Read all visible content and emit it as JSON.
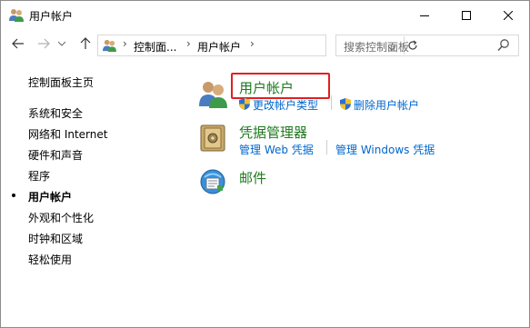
{
  "window": {
    "title": "用户帐户"
  },
  "nav": {
    "breadcrumb": [
      "控制面...",
      "用户帐户"
    ],
    "search_placeholder": "搜索控制面板"
  },
  "sidebar": {
    "items": [
      {
        "label": "控制面板主页",
        "current": false
      },
      {
        "label": "系统和安全",
        "current": false
      },
      {
        "label": "网络和 Internet",
        "current": false
      },
      {
        "label": "硬件和声音",
        "current": false
      },
      {
        "label": "程序",
        "current": false
      },
      {
        "label": "用户帐户",
        "current": true
      },
      {
        "label": "外观和个性化",
        "current": false
      },
      {
        "label": "时钟和区域",
        "current": false
      },
      {
        "label": "轻松使用",
        "current": false
      }
    ]
  },
  "categories": [
    {
      "title": "用户帐户",
      "icon": "users-icon",
      "links": [
        "更改帐户类型",
        "删除用户帐户"
      ]
    },
    {
      "title": "凭据管理器",
      "icon": "credential-vault-icon",
      "links": [
        "管理 Web 凭据",
        "管理 Windows 凭据"
      ]
    },
    {
      "title": "邮件",
      "icon": "mail-icon",
      "links": []
    }
  ],
  "colors": {
    "category_title": "#1e7a1e",
    "link": "#0066cc",
    "highlight_border": "#e02020"
  }
}
